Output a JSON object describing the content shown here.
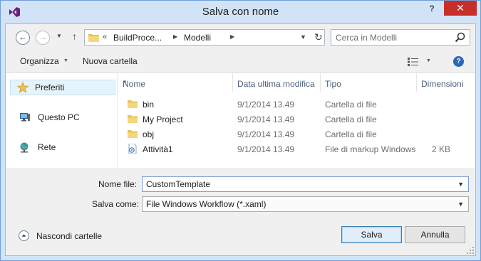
{
  "window": {
    "title": "Salva con nome",
    "help_glyph": "?",
    "close_glyph": "✕",
    "app_icon": "visual-studio-icon",
    "accent_color": "#c7302a"
  },
  "address_bar": {
    "overflow_glyph": "«",
    "crumbs": [
      "BuildProce...",
      "Modelli"
    ]
  },
  "search": {
    "placeholder": "Cerca in Modelli"
  },
  "toolbar": {
    "organize_label": "Organizza",
    "new_folder_label": "Nuova cartella"
  },
  "nav": {
    "items": [
      {
        "label": "Preferiti",
        "icon": "star-icon",
        "selected": true
      },
      {
        "label": "Questo PC",
        "icon": "computer-icon",
        "selected": false
      },
      {
        "label": "Rete",
        "icon": "network-icon",
        "selected": false
      }
    ]
  },
  "columns": [
    "Nome",
    "Data ultima modifica",
    "Tipo",
    "Dimensioni"
  ],
  "files": [
    {
      "name": "bin",
      "modified": "9/1/2014 13.49",
      "type": "Cartella di file",
      "size": "",
      "icon": "folder-icon"
    },
    {
      "name": "My Project",
      "modified": "9/1/2014 13.49",
      "type": "Cartella di file",
      "size": "",
      "icon": "folder-icon"
    },
    {
      "name": "obj",
      "modified": "9/1/2014 13.49",
      "type": "Cartella di file",
      "size": "",
      "icon": "folder-icon"
    },
    {
      "name": "Attività1",
      "modified": "9/1/2014 13.49",
      "type": "File di markup Windows",
      "size": "2 KB",
      "icon": "xaml-file-icon"
    }
  ],
  "form": {
    "filename_label": "Nome file:",
    "filename_value": "CustomTemplate",
    "filetype_label": "Salva come:",
    "filetype_value": "File Windows Workflow (*.xaml)"
  },
  "footer": {
    "hide_folders_label": "Nascondi cartelle",
    "save_label": "Salva",
    "cancel_label": "Annulla"
  }
}
